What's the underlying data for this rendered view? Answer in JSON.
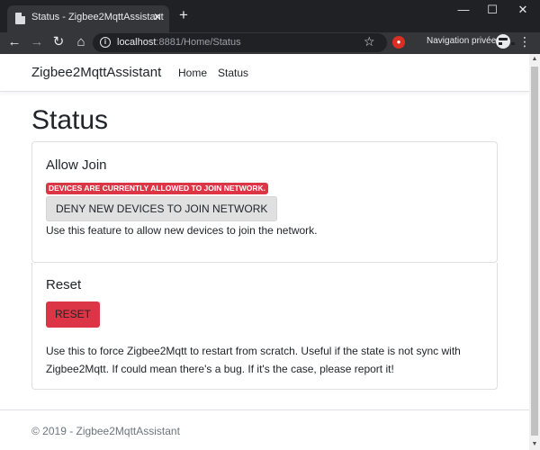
{
  "browser": {
    "tab_title": "Status - Zigbee2MqttAssistant",
    "tab_close": "✕",
    "new_tab": "+",
    "window_controls": {
      "minimize": "—",
      "maximize": "☐",
      "close": "✕"
    },
    "nav": {
      "back": "←",
      "forward": "→",
      "reload": "↻",
      "home": "⌂"
    },
    "url_host": "localhost",
    "url_rest": ":8881/Home/Status",
    "info_glyph": "i",
    "star": "☆",
    "ext_glyph": "●",
    "incognito_label": "Navigation privée",
    "menu": "⋮"
  },
  "navbar": {
    "brand": "Zigbee2MqttAssistant",
    "links": [
      "Home",
      "Status"
    ]
  },
  "page": {
    "title": "Status"
  },
  "allow_join": {
    "title": "Allow Join",
    "badge": "DEVICES ARE CURRENTLY ALLOWED TO JOIN NETWORK.",
    "button": "DENY NEW DEVICES TO JOIN NETWORK",
    "description": "Use this feature to allow new devices to join the network."
  },
  "reset": {
    "title": "Reset",
    "button": "RESET",
    "description": "Use this to force Zigbee2Mqtt to restart from scratch. Useful if the state is not sync with Zigbee2Mqtt. If could mean there's a bug. If it's the case, please report it!"
  },
  "footer": {
    "text": "© 2019 - Zigbee2MqttAssistant"
  },
  "scrollbar": {
    "up": "▲",
    "down": "▼"
  },
  "colors": {
    "danger": "#dc3545",
    "secondary_button": "#e0e0e0",
    "chrome_dark": "#202124",
    "chrome_toolbar": "#35363a"
  }
}
